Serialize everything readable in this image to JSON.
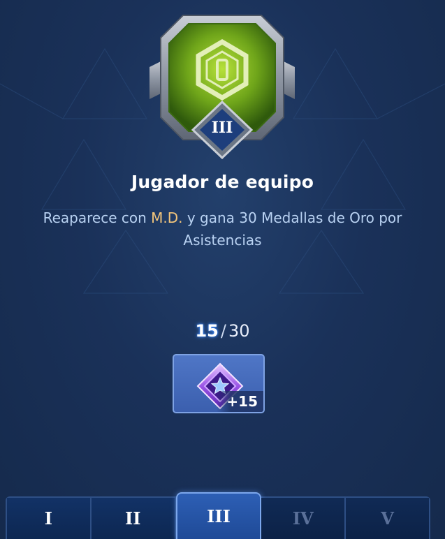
{
  "achievement": {
    "tier_label": "III",
    "title": "Jugador de equipo",
    "description_pre": "Reaparece con ",
    "description_highlight": "M.D.",
    "description_post": " y gana 30 Medallas de Oro por Asistencias",
    "icon": "hexagon-emblem-icon"
  },
  "progress": {
    "current": "15",
    "separator": "/",
    "total": "30"
  },
  "reward": {
    "icon": "purple-star-diamond-icon",
    "amount": "+15"
  },
  "tiers": [
    {
      "label": "I",
      "state": "completed"
    },
    {
      "label": "II",
      "state": "completed"
    },
    {
      "label": "III",
      "state": "active"
    },
    {
      "label": "IV",
      "state": "locked"
    },
    {
      "label": "V",
      "state": "locked"
    }
  ],
  "colors": {
    "highlight": "#f3c57b",
    "badge_green": "#7ab01c",
    "active_tab": "#2d5fb5"
  }
}
